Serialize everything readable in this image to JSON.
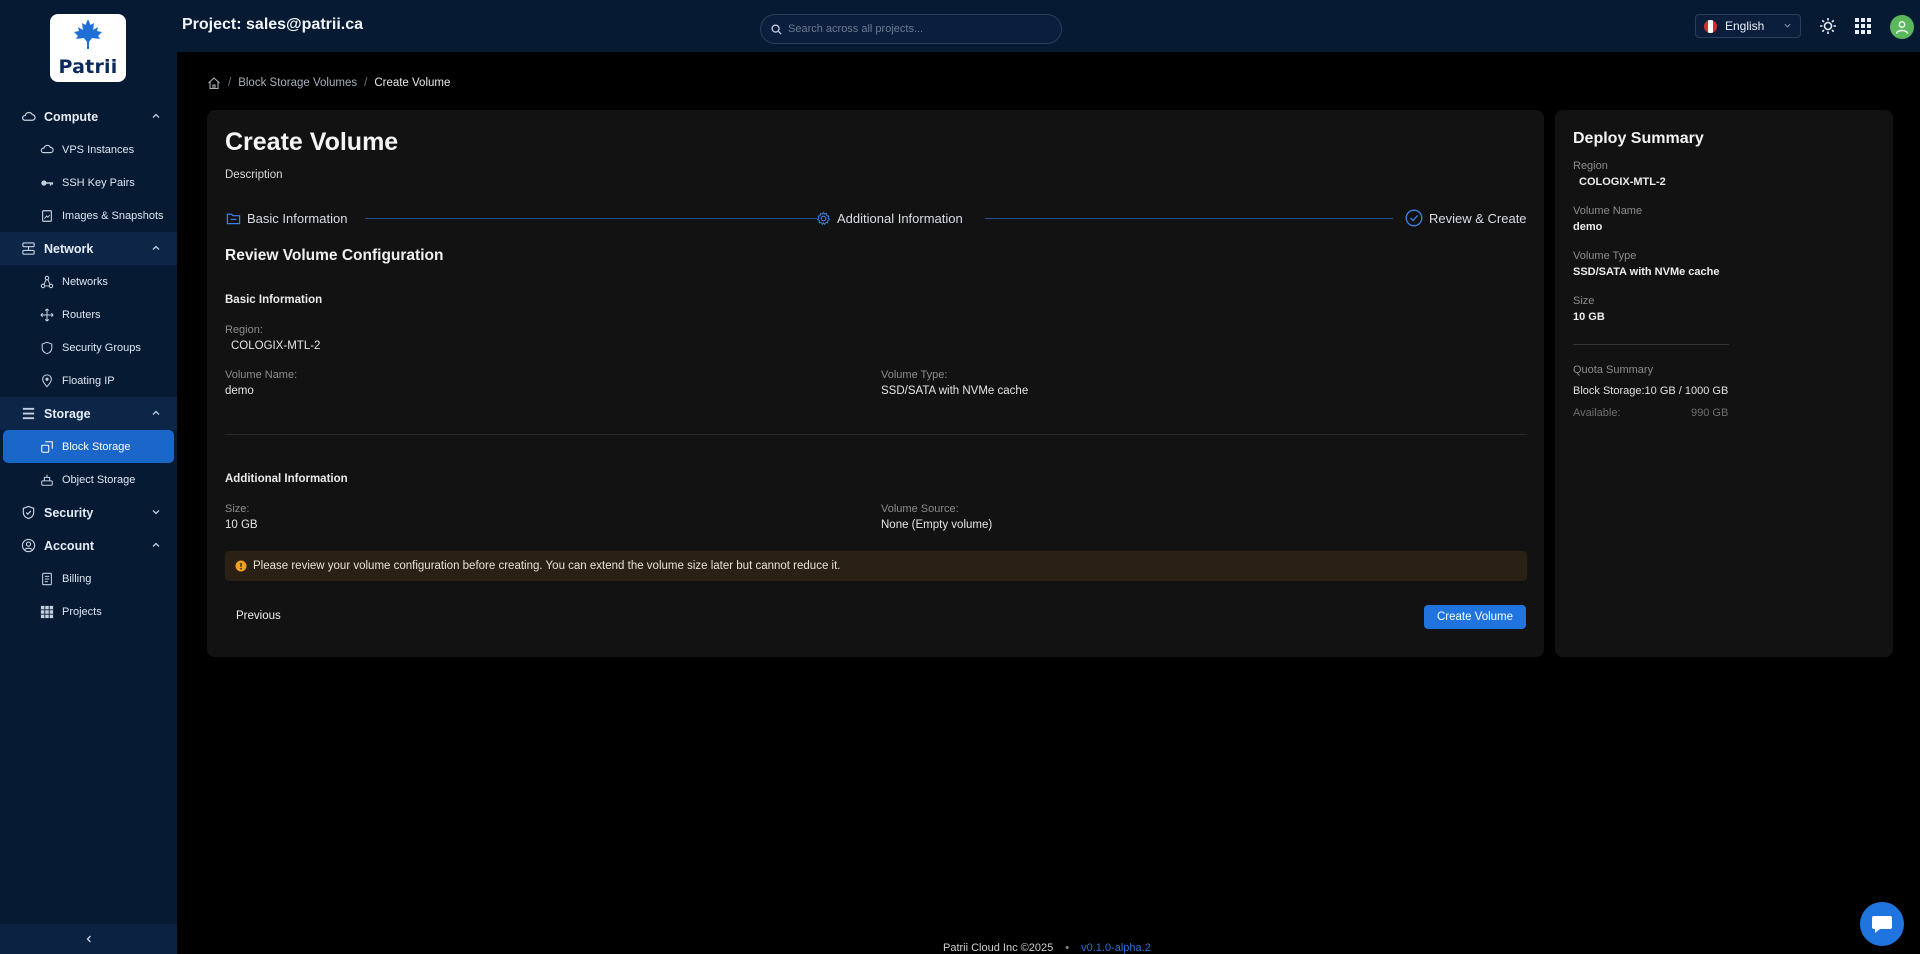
{
  "brand": {
    "logo_text": "Patrii"
  },
  "topbar": {
    "project_title": "Project: sales@patrii.ca",
    "search_placeholder": "Search across all projects...",
    "language": "English"
  },
  "sidebar": {
    "compute": {
      "label": "Compute",
      "items": [
        "VPS Instances",
        "SSH Key Pairs",
        "Images & Snapshots"
      ]
    },
    "network": {
      "label": "Network",
      "items": [
        "Networks",
        "Routers",
        "Security Groups",
        "Floating IP"
      ]
    },
    "storage": {
      "label": "Storage",
      "items": [
        "Block Storage",
        "Object Storage"
      ]
    },
    "security": {
      "label": "Security"
    },
    "account": {
      "label": "Account",
      "items": [
        "Billing",
        "Projects"
      ]
    }
  },
  "breadcrumb": {
    "level1": "Block Storage Volumes",
    "current": "Create Volume"
  },
  "main": {
    "title": "Create Volume",
    "description": "Description",
    "steps": [
      "Basic Information",
      "Additional Information",
      "Review & Create"
    ],
    "section_title": "Review Volume Configuration",
    "basic": {
      "title": "Basic Information",
      "region_label": "Region:",
      "region_value": "COLOGIX-MTL-2",
      "name_label": "Volume Name:",
      "name_value": "demo",
      "type_label": "Volume Type:",
      "type_value": "SSD/SATA with NVMe cache"
    },
    "additional": {
      "title": "Additional Information",
      "size_label": "Size:",
      "size_value": "10 GB",
      "source_label": "Volume Source:",
      "source_value": "None (Empty volume)"
    },
    "alert": "Please review your volume configuration before creating. You can extend the volume size later but cannot reduce it.",
    "previous_label": "Previous",
    "create_label": "Create Volume"
  },
  "summary": {
    "title": "Deploy Summary",
    "region_label": "Region",
    "region_value": "COLOGIX-MTL-2",
    "name_label": "Volume Name",
    "name_value": "demo",
    "type_label": "Volume Type",
    "type_value": "SSD/SATA with NVMe cache",
    "size_label": "Size",
    "size_value": "10 GB",
    "quota_title": "Quota Summary",
    "quota_line": "Block Storage:10 GB / 1000 GB",
    "available_label": "Available:",
    "available_value": "990 GB"
  },
  "footer": {
    "copyright": "Patrii Cloud Inc ©2025",
    "version": "v0.1.0-alpha.2"
  },
  "colors": {
    "accent": "#1f74e0",
    "sidebar_bg": "#061a33",
    "card_bg": "#121212",
    "success": "#5cb85c",
    "warning": "#f0a020"
  }
}
